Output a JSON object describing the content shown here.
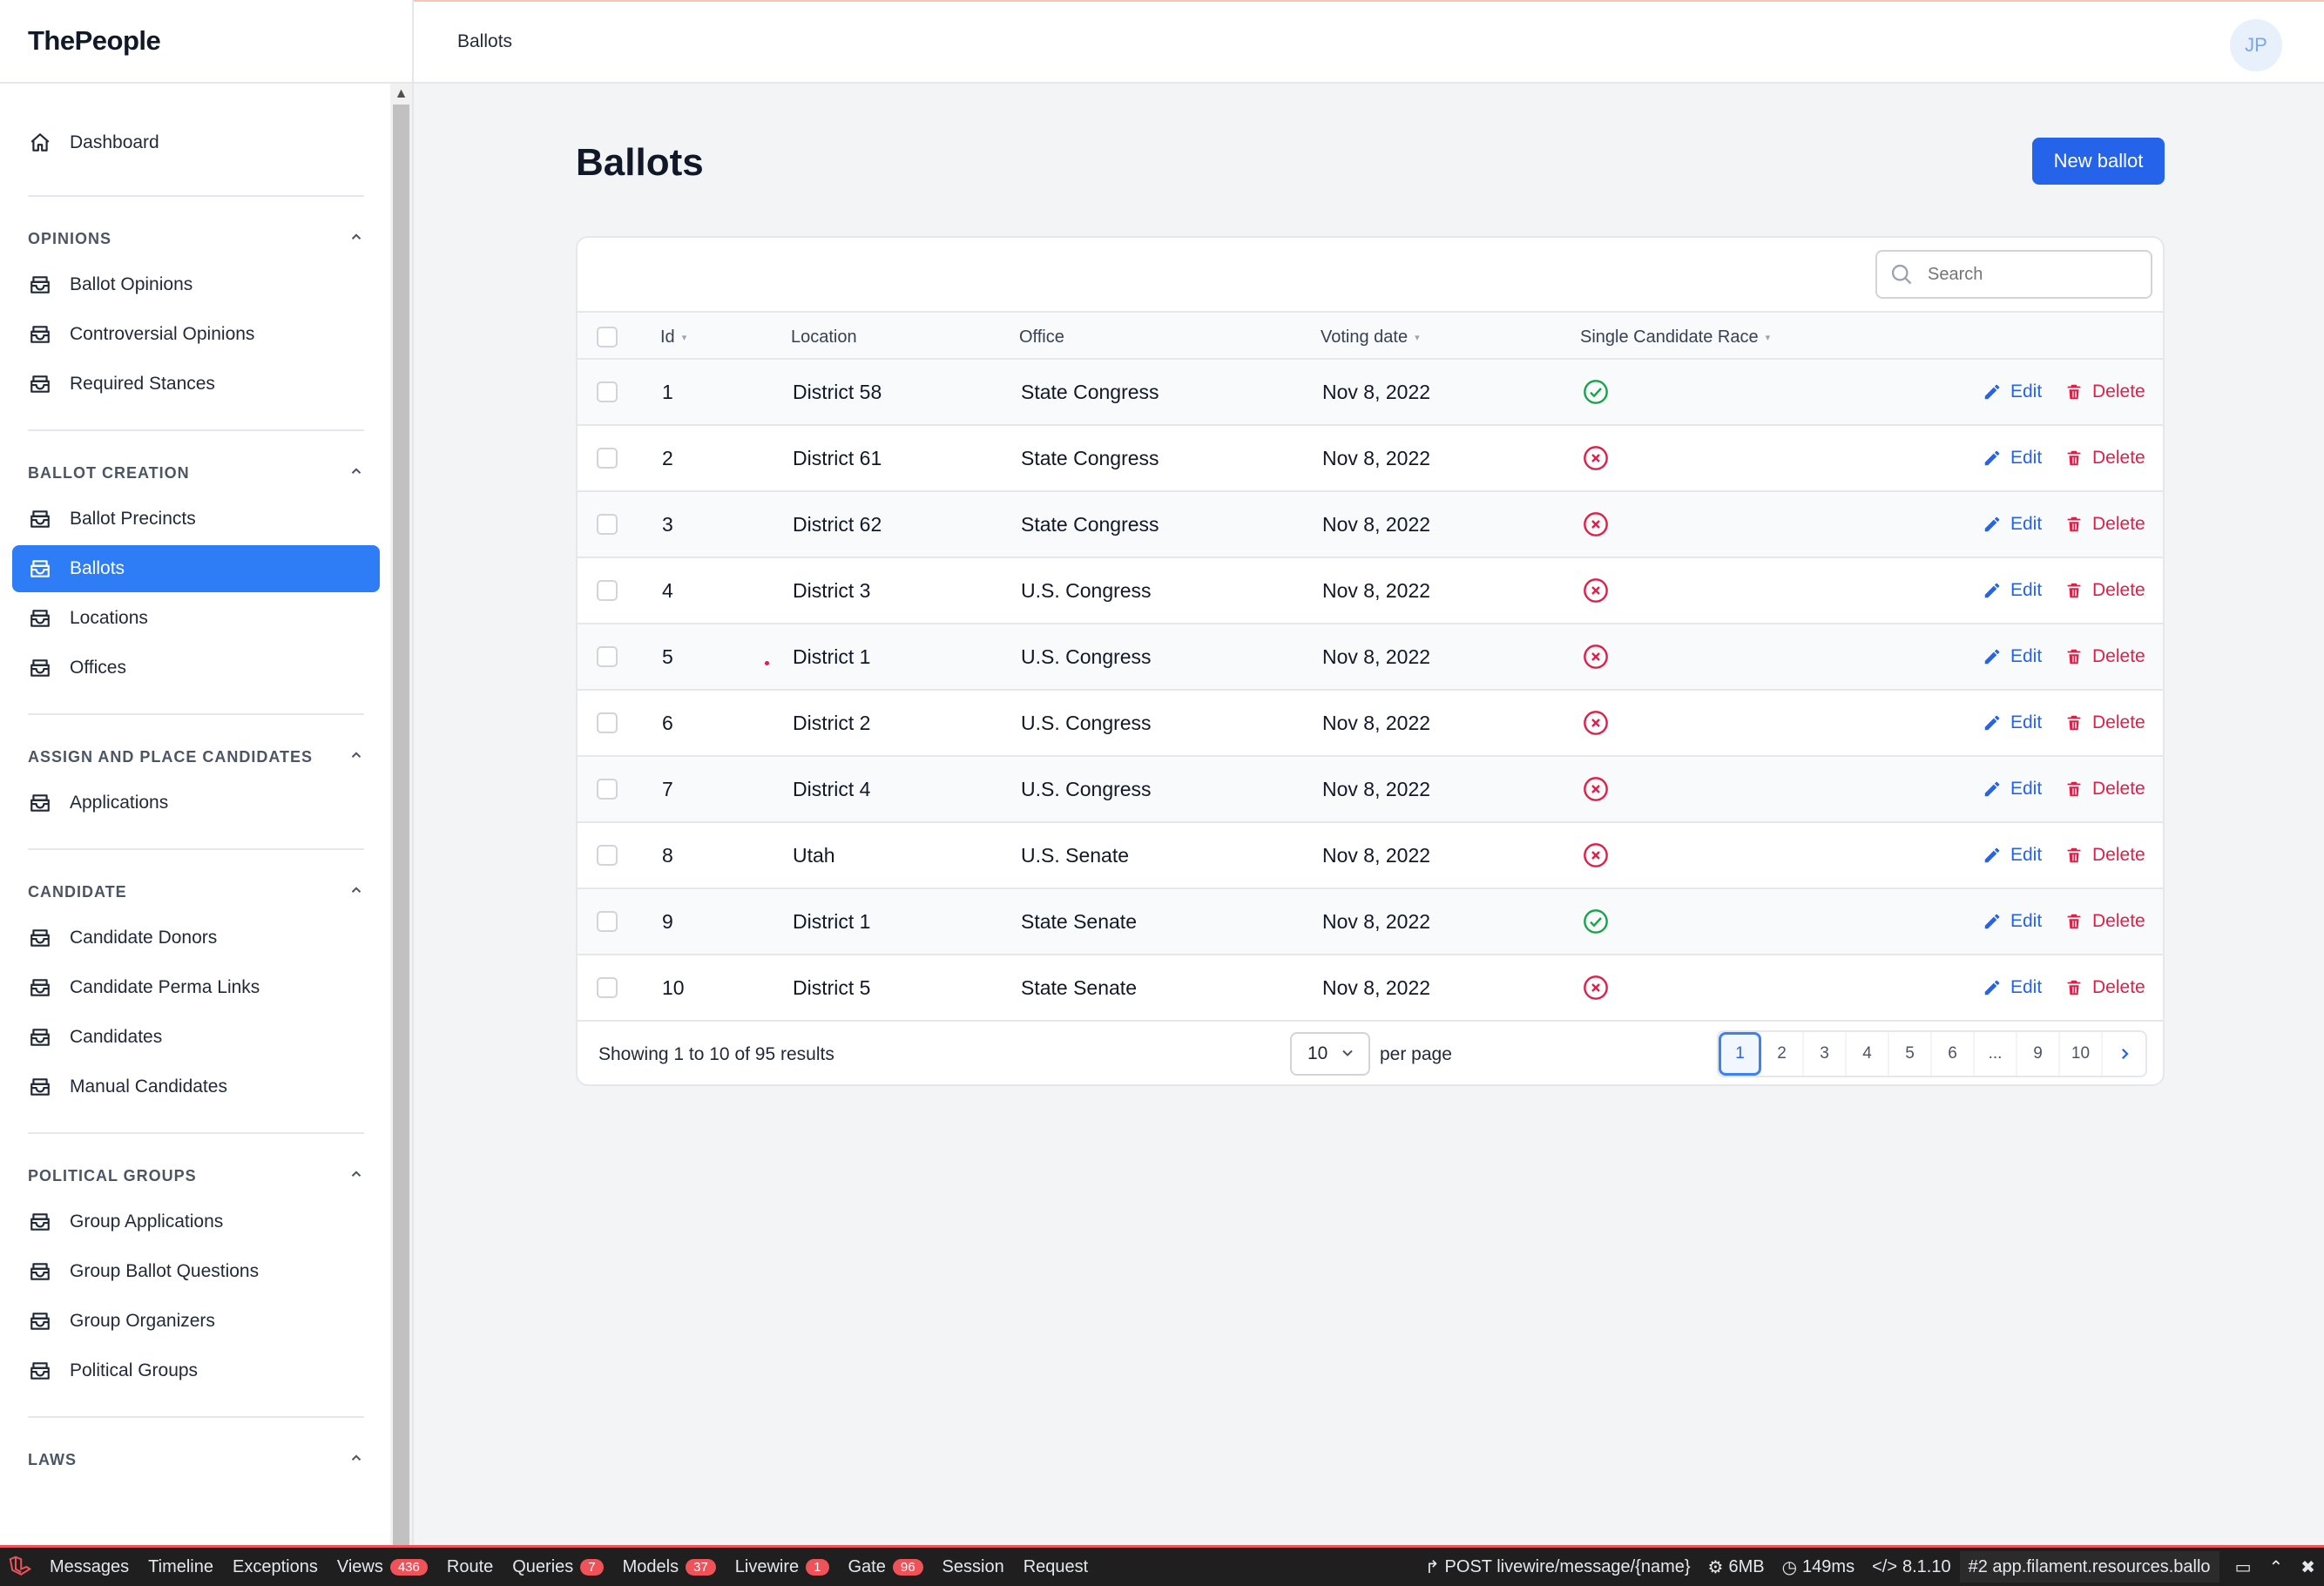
{
  "app": {
    "brand": "ThePeople"
  },
  "topbar": {
    "breadcrumb": "Ballots",
    "avatar_initials": "JP"
  },
  "sidebar": {
    "dashboard": "Dashboard",
    "groups": [
      {
        "title": "OPINIONS",
        "items": [
          "Ballot Opinions",
          "Controversial Opinions",
          "Required Stances"
        ]
      },
      {
        "title": "BALLOT CREATION",
        "items": [
          "Ballot Precincts",
          "Ballots",
          "Locations",
          "Offices"
        ],
        "active": "Ballots"
      },
      {
        "title": "ASSIGN AND PLACE CANDIDATES",
        "items": [
          "Applications"
        ]
      },
      {
        "title": "CANDIDATE",
        "items": [
          "Candidate Donors",
          "Candidate Perma Links",
          "Candidates",
          "Manual Candidates"
        ]
      },
      {
        "title": "POLITICAL GROUPS",
        "items": [
          "Group Applications",
          "Group Ballot Questions",
          "Group Organizers",
          "Political Groups"
        ]
      },
      {
        "title": "LAWS",
        "items": []
      }
    ]
  },
  "main": {
    "title": "Ballots",
    "new_button": "New ballot",
    "search_placeholder": "Search"
  },
  "table": {
    "columns": [
      "Id",
      "Location",
      "Office",
      "Voting date",
      "Single Candidate Race"
    ],
    "edit_label": "Edit",
    "delete_label": "Delete",
    "rows": [
      {
        "id": "1",
        "location": "District 58",
        "office": "State Congress",
        "date": "Nov 8, 2022",
        "single": true
      },
      {
        "id": "2",
        "location": "District 61",
        "office": "State Congress",
        "date": "Nov 8, 2022",
        "single": false
      },
      {
        "id": "3",
        "location": "District 62",
        "office": "State Congress",
        "date": "Nov 8, 2022",
        "single": false
      },
      {
        "id": "4",
        "location": "District 3",
        "office": "U.S. Congress",
        "date": "Nov 8, 2022",
        "single": false
      },
      {
        "id": "5",
        "location": "District 1",
        "office": "U.S. Congress",
        "date": "Nov 8, 2022",
        "single": false
      },
      {
        "id": "6",
        "location": "District 2",
        "office": "U.S. Congress",
        "date": "Nov 8, 2022",
        "single": false
      },
      {
        "id": "7",
        "location": "District 4",
        "office": "U.S. Congress",
        "date": "Nov 8, 2022",
        "single": false
      },
      {
        "id": "8",
        "location": "Utah",
        "office": "U.S. Senate",
        "date": "Nov 8, 2022",
        "single": false
      },
      {
        "id": "9",
        "location": "District 1",
        "office": "State Senate",
        "date": "Nov 8, 2022",
        "single": true
      },
      {
        "id": "10",
        "location": "District 5",
        "office": "State Senate",
        "date": "Nov 8, 2022",
        "single": false
      }
    ],
    "summary": "Showing 1 to 10 of 95 results",
    "per_page_value": "10",
    "per_page_label": "per page",
    "pages": [
      "1",
      "2",
      "3",
      "4",
      "5",
      "6",
      "...",
      "9",
      "10"
    ],
    "current_page": "1"
  },
  "debugbar": {
    "tabs": [
      {
        "label": "Messages"
      },
      {
        "label": "Timeline"
      },
      {
        "label": "Exceptions"
      },
      {
        "label": "Views",
        "badge": "436"
      },
      {
        "label": "Route"
      },
      {
        "label": "Queries",
        "badge": "7"
      },
      {
        "label": "Models",
        "badge": "37"
      },
      {
        "label": "Livewire",
        "badge": "1"
      },
      {
        "label": "Gate",
        "badge": "96"
      },
      {
        "label": "Session"
      },
      {
        "label": "Request"
      }
    ],
    "request": "POST livewire/message/{name}",
    "memory": "6MB",
    "time": "149ms",
    "php_version": "8.1.10",
    "request_select": "#2 app.filament.resources.ballo"
  },
  "colors": {
    "accent": "#2563eb",
    "danger": "#e11d48",
    "success": "#16a34a",
    "active_nav": "#2e7cf6"
  }
}
